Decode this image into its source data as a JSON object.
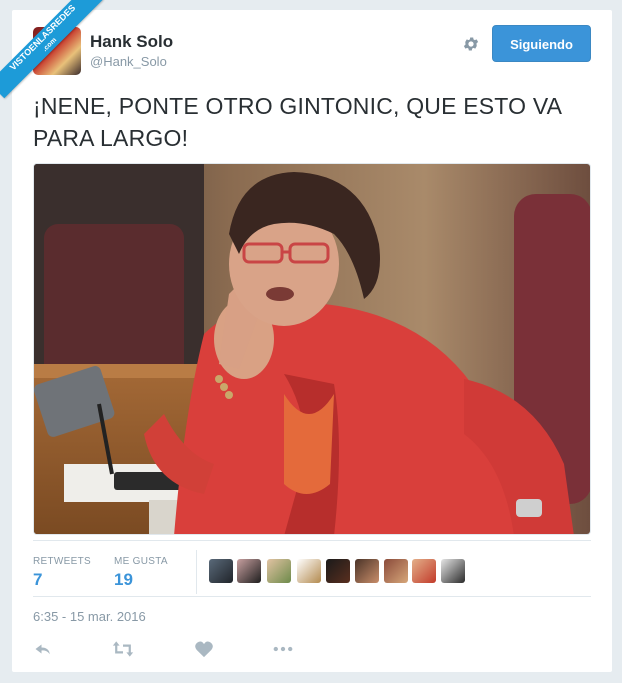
{
  "watermark": {
    "line1": "VISTOENLASREDES",
    "line2": ".com"
  },
  "user": {
    "display_name": "Hank Solo",
    "handle": "@Hank_Solo"
  },
  "follow_button": {
    "label": "Siguiendo"
  },
  "tweet": {
    "text": "¡NENE, PONTE OTRO GINTONIC, QUE ESTO VA PARA LARGO!"
  },
  "stats": {
    "retweets_label": "RETWEETS",
    "retweets_value": "7",
    "likes_label": "ME GUSTA",
    "likes_value": "19"
  },
  "timestamp": "6:35 - 15 mar. 2016",
  "icons": {
    "gear": "gear-icon",
    "reply": "reply-icon",
    "retweet": "retweet-icon",
    "like": "heart-icon",
    "more": "more-icon"
  },
  "colors": {
    "brand_blue": "#3b94d9",
    "ribbon_blue": "#1d9bd8",
    "text": "#292f33",
    "muted": "#8899a6",
    "icon_gray": "#aab8c2"
  }
}
